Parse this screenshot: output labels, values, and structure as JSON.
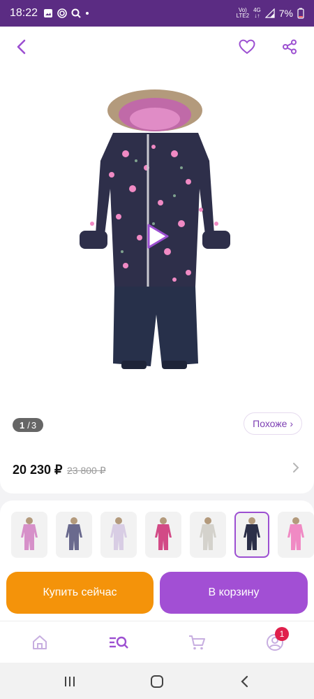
{
  "status_bar": {
    "time": "18:22",
    "network_top": "Vo)",
    "network_bottom": "LTE2",
    "data_top": "4G",
    "battery": "7%"
  },
  "nav": {
    "back_icon": "chevron-left-icon",
    "favorite_icon": "heart-icon",
    "share_icon": "share-icon"
  },
  "gallery": {
    "current": "1",
    "total": "3",
    "separator": "/"
  },
  "similar_label": "Похоже ›",
  "price": {
    "current": "20 230 ₽",
    "old": "23 800 ₽"
  },
  "thumbnails": [
    {
      "name": "pink snowsuit",
      "color": "#d690c9"
    },
    {
      "name": "child in snowsuit",
      "color": "#6a6a8e"
    },
    {
      "name": "light snowsuit",
      "color": "#d8cde4"
    },
    {
      "name": "pink dark snowsuit",
      "color": "#d24a86"
    },
    {
      "name": "child white snowsuit",
      "color": "#d4d2cc"
    },
    {
      "name": "navy snowsuit",
      "color": "#2b2f48"
    },
    {
      "name": "bright pink snowsuit",
      "color": "#f08ac4"
    }
  ],
  "actions": {
    "buy_now": "Купить сейчас",
    "add_to_cart": "В корзину"
  },
  "tabbar": {
    "cart_badge": "1"
  },
  "colors": {
    "accent": "#a24fd4",
    "buy": "#f4930a",
    "status_bar": "#5b2c83"
  }
}
